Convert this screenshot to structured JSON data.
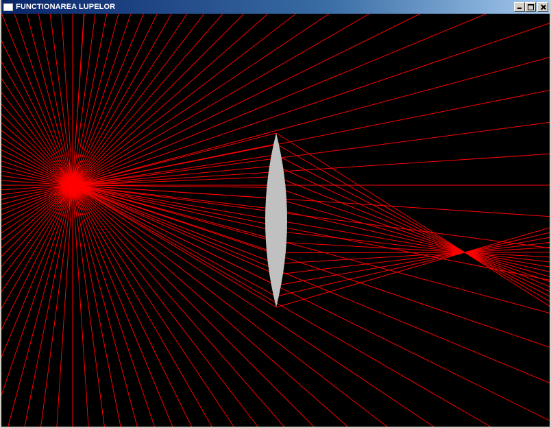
{
  "window": {
    "title": "FUNCTIONAREA LUPELOR",
    "icon": "app-window-icon",
    "buttons": [
      "minimize-icon",
      "maximize-icon",
      "close-icon"
    ]
  },
  "scene": {
    "background_color": "#000000",
    "ray_color": "#ff0000",
    "lens_color": "#c0c0c0",
    "elements": [
      "light-source",
      "convex-lens",
      "rays"
    ]
  }
}
